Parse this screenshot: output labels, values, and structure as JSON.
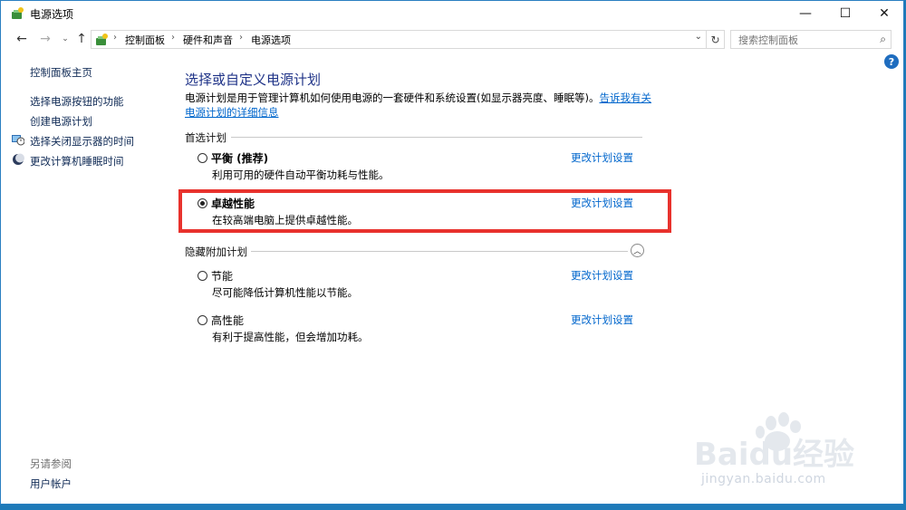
{
  "window": {
    "title": "电源选项",
    "minimize": "—",
    "maximize": "☐",
    "close": "✕"
  },
  "nav": {
    "back": "←",
    "forward": "→",
    "recent": "⌄",
    "up": "↑",
    "breadcrumbs": [
      "控制面板",
      "硬件和声音",
      "电源选项"
    ],
    "separator": "›",
    "dropdown": "⌄",
    "refresh": "↻",
    "search_placeholder": "搜索控制面板",
    "search_icon": "⌕"
  },
  "help": "?",
  "sidebar": {
    "home": "控制面板主页",
    "items": [
      {
        "label": "选择电源按钮的功能",
        "icon": ""
      },
      {
        "label": "创建电源计划",
        "icon": ""
      },
      {
        "label": "选择关闭显示器的时间",
        "icon": "monitor-clock-icon"
      },
      {
        "label": "更改计算机睡眠时间",
        "icon": "moon-icon"
      }
    ],
    "see_also_label": "另请参阅",
    "see_also_items": [
      "用户帐户"
    ]
  },
  "main": {
    "title": "选择或自定义电源计划",
    "description": "电源计划是用于管理计算机如何使用电源的一套硬件和系统设置(如显示器亮度、睡眠等)。",
    "learn_more_link": "告诉我有关电源计划的详细信息",
    "preferred_section": "首选计划",
    "hidden_section": "隐藏附加计划",
    "collapse_icon": "︿",
    "change_link": "更改计划设置",
    "preferred_plans": [
      {
        "name": "平衡 (推荐)",
        "desc": "利用可用的硬件自动平衡功耗与性能。",
        "selected": false
      },
      {
        "name": "卓越性能",
        "desc": "在较高端电脑上提供卓越性能。",
        "selected": true
      }
    ],
    "hidden_plans": [
      {
        "name": "节能",
        "desc": "尽可能降低计算机性能以节能。",
        "selected": false
      },
      {
        "name": "高性能",
        "desc": "有利于提高性能，但会增加功耗。",
        "selected": false
      }
    ]
  },
  "watermark": {
    "logo_text": "Baidu经验",
    "url": "jingyan.baidu.com"
  },
  "colors": {
    "link": "#0066cc",
    "title_blue": "#1e3287",
    "highlight_red": "#e8322d",
    "desktop_blue": "#1e7ab8"
  }
}
